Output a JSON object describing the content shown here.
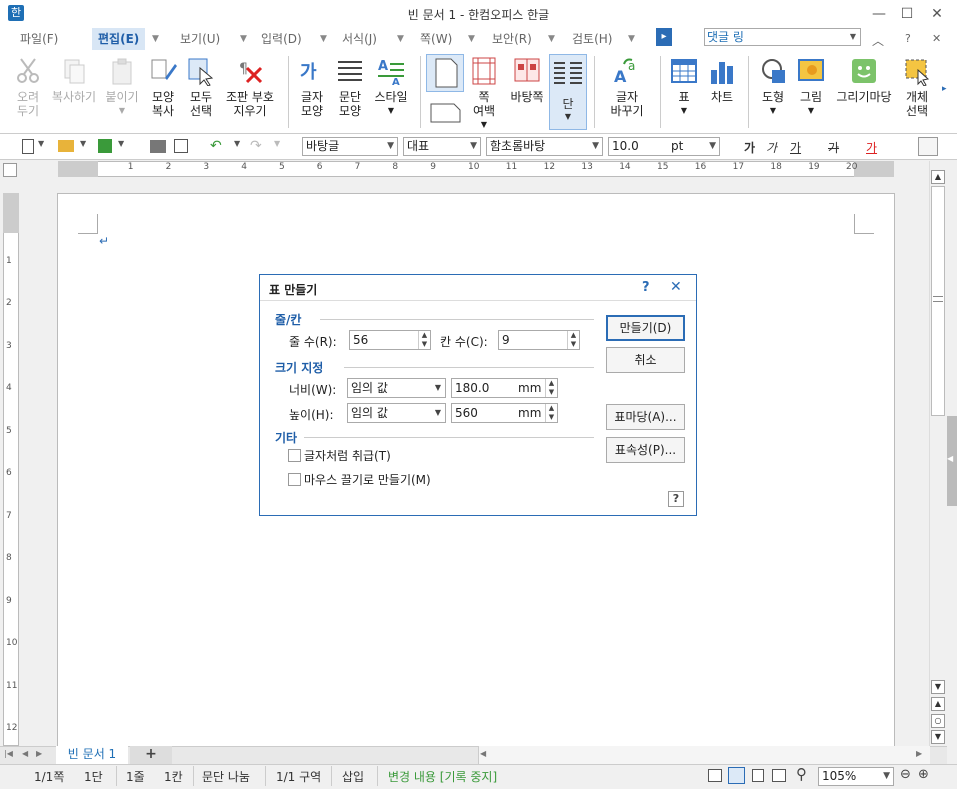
{
  "window": {
    "title": "빈 문서 1 - 한컴오피스 한글",
    "app_icon": "한",
    "minimize": "—",
    "maximize": "☐",
    "close": "✕"
  },
  "menu": {
    "items": [
      "파일(F)",
      "편집(E)",
      "보기(U)",
      "입력(D)",
      "서식(J)",
      "쪽(W)",
      "보안(R)",
      "검토(H)"
    ],
    "active_index": 1,
    "more": "▸",
    "comment_combo": "댓글 링",
    "collapse": "︿",
    "help": "?",
    "close": "✕"
  },
  "ribbon": {
    "cut": "오려\n두기",
    "copy": "복사하기",
    "paste": "붙이기",
    "format_copy": "모양\n복사",
    "select_all": "모두\n선택",
    "clear_symbols": "조판 부호\n지우기",
    "char_shape": "글자\n모양",
    "para_shape": "문단\n모양",
    "style": "스타일",
    "page_margin": "쪽\n여백",
    "master_page": "바탕쪽",
    "columns": "단",
    "replace": "글자\n바꾸기",
    "table": "표",
    "chart": "차트",
    "shape": "도형",
    "picture": "그림",
    "drawing": "그리기마당",
    "object_select": "개체\n선택"
  },
  "toolbar2": {
    "style_combo": "바탕글",
    "lang_combo": "대표",
    "font_combo": "함초롬바탕",
    "size_value": "10.0",
    "size_unit": "pt",
    "bold": "가",
    "italic": "가",
    "underline": "가",
    "strike": "가",
    "color": "가"
  },
  "ruler": {
    "h_numbers": [
      "1",
      "2",
      "3",
      "4",
      "5",
      "6",
      "7",
      "8",
      "9",
      "10",
      "11",
      "12",
      "13",
      "14",
      "15",
      "16",
      "17",
      "18",
      "19",
      "20"
    ],
    "v_numbers": [
      "1",
      "2",
      "3",
      "4",
      "5",
      "6",
      "7",
      "8",
      "9",
      "10",
      "11",
      "12"
    ]
  },
  "document": {
    "paragraph_mark": "↵"
  },
  "dialog": {
    "title": "표 만들기",
    "help": "?",
    "close": "✕",
    "group_rowcol": "줄/칸",
    "rows_label": "줄 수(R):",
    "rows_value": "56",
    "cols_label": "칸 수(C):",
    "cols_value": "9",
    "group_size": "크기 지정",
    "width_label": "너비(W):",
    "width_mode": "임의 값",
    "width_value": "180.0",
    "width_unit": "mm",
    "height_label": "높이(H):",
    "height_mode": "임의 값",
    "height_value": "560",
    "height_unit": "mm",
    "group_etc": "기타",
    "treat_as_char": "글자처럼 취급(T)",
    "treat_as_char_checked": false,
    "mouse_drag": "마우스 끌기로 만들기(M)",
    "mouse_drag_checked": false,
    "create_btn": "만들기(D)",
    "cancel_btn": "취소",
    "table_style_btn": "표마당(A)...",
    "table_props_btn": "표속성(P)...",
    "help_btn": "?"
  },
  "tabs": {
    "doc_tab": "빈 문서 1",
    "add_tab": "+"
  },
  "status": {
    "page": "1/1쪽",
    "column": "1단",
    "line": "1줄",
    "col": "1칸",
    "break": "문단 나눔",
    "section": "1/1 구역",
    "insert": "삽입",
    "track": "변경 내용 [기록 중지]",
    "zoom": "105%"
  }
}
